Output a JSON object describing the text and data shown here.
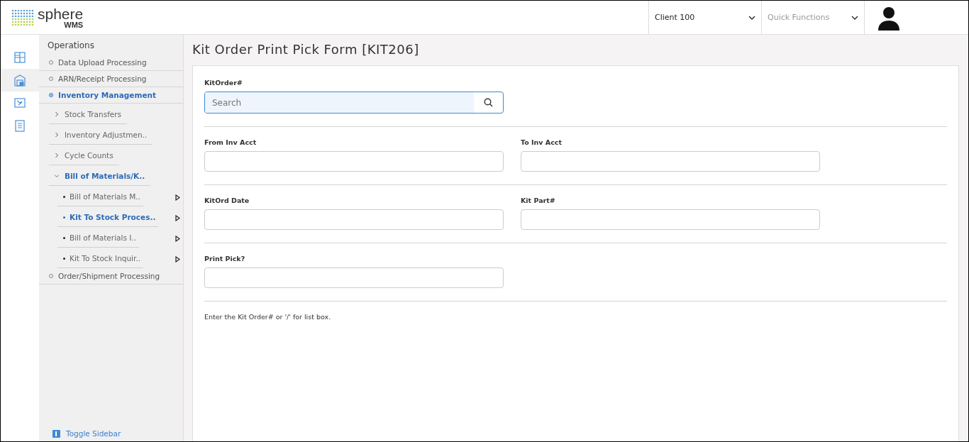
{
  "logo": {
    "name": "sphere",
    "sub": "WMS"
  },
  "header": {
    "client_select": {
      "value": "Client 100"
    },
    "quick_functions": {
      "placeholder": "Quick Functions"
    }
  },
  "icon_rail": [
    {
      "kind": "grid",
      "selected": false
    },
    {
      "kind": "warehouse",
      "selected": true
    },
    {
      "kind": "map",
      "selected": false
    },
    {
      "kind": "report",
      "selected": false
    }
  ],
  "sidebar": {
    "heading": "Operations",
    "items": [
      {
        "label": "Data Upload Processing",
        "selected": false
      },
      {
        "label": "ARN/Receipt Processing",
        "selected": false
      },
      {
        "label": "Inventory Management",
        "selected": true,
        "children": [
          {
            "label": "Stock Transfers",
            "selected": false,
            "expanded": false
          },
          {
            "label": "Inventory Adjustmen..",
            "selected": false,
            "expanded": false
          },
          {
            "label": "Cycle Counts",
            "selected": false,
            "expanded": false
          },
          {
            "label": "Bill of Materials/K..",
            "selected": true,
            "expanded": true,
            "children": [
              {
                "label": "Bill of Materials M..",
                "selected": false
              },
              {
                "label": "Kit To Stock Proces..",
                "selected": true
              },
              {
                "label": "Bill of Materials I..",
                "selected": false
              },
              {
                "label": "Kit To Stock Inquir..",
                "selected": false
              }
            ]
          }
        ]
      },
      {
        "label": "Order/Shipment Processing",
        "selected": false
      }
    ],
    "toggle": "Toggle Sidebar"
  },
  "page": {
    "title": "Kit Order Print Pick Form [KIT206]",
    "search": {
      "label": "KitOrder#",
      "placeholder": "Search"
    },
    "rows": [
      [
        {
          "label": "From Inv Acct"
        },
        {
          "label": "To Inv Acct"
        }
      ],
      [
        {
          "label": "KitOrd Date"
        },
        {
          "label": "Kit Part#"
        }
      ],
      [
        {
          "label": "Print Pick?"
        }
      ]
    ],
    "hint": "Enter the Kit Order# or '/' for list box."
  }
}
